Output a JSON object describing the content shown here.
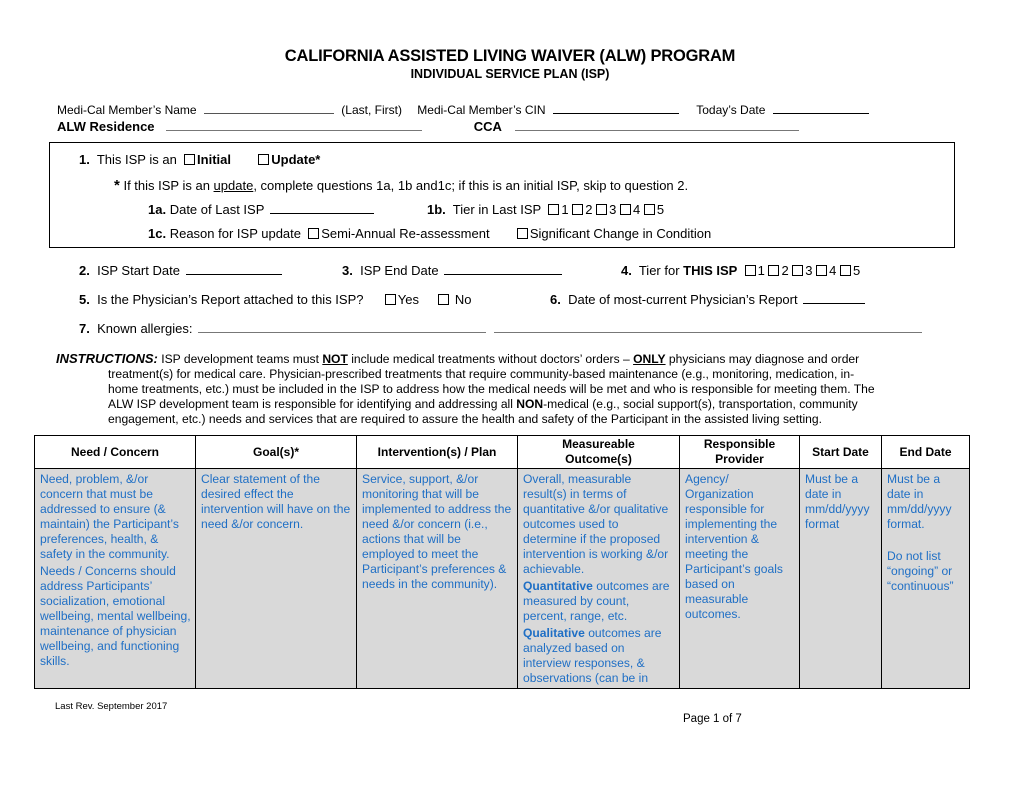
{
  "header": {
    "title": "CALIFORNIA ASSISTED LIVING WAIVER (ALW) PROGRAM",
    "subtitle": "INDIVIDUAL SERVICE PLAN (ISP)"
  },
  "member_info": {
    "name_label": "Medi-Cal Member’s Name",
    "name_value": "",
    "name_hint": "(Last, First)",
    "cin_label": "Medi-Cal Member’s CIN",
    "cin_value": "",
    "today_label": "Today’s Date",
    "today_value": "",
    "residence_label": "ALW Residence",
    "residence_value": "",
    "cca_label": "CCA",
    "cca_value": ""
  },
  "question1": {
    "number": "1.",
    "text": "This ISP is an",
    "option_initial": "Initial",
    "option_update": "Update*",
    "initial_checked": false,
    "update_checked": false,
    "note_star": "*",
    "note_pre": " If this ISP is an ",
    "note_link": "update",
    "note_post": ", complete questions 1a, 1b and1c; if this is an initial ISP, skip to question 2.",
    "q1a_num": "1a.",
    "q1a_label": "Date of Last ISP",
    "q1a_value": "",
    "q1b_num": "1b.",
    "q1b_label": "Tier in Last ISP",
    "q1b_tiers": [
      "1",
      "2",
      "3",
      "4",
      "5"
    ],
    "q1c_num": "1c.",
    "q1c_label": "Reason for ISP update",
    "q1c_option1": "Semi-Annual Re-assessment",
    "q1c_option2": "Significant Change in Condition"
  },
  "question2": {
    "number": "2.",
    "label": "ISP Start Date",
    "value": ""
  },
  "question3": {
    "number": "3.",
    "label": "ISP End Date",
    "value": ""
  },
  "question4": {
    "number": "4.",
    "label_pre": "Tier for ",
    "label_bold": "THIS ISP",
    "tiers": [
      "1",
      "2",
      "3",
      "4",
      "5"
    ]
  },
  "question5": {
    "number": "5.",
    "label": "Is the Physician’s Report attached to this ISP?",
    "yes": "Yes",
    "no": "No"
  },
  "question6": {
    "number": "6.",
    "label": "Date of most-current Physician’s Report",
    "value": ""
  },
  "question7": {
    "number": "7.",
    "label": "Known allergies:",
    "value": ""
  },
  "instructions": {
    "heading": "INSTRUCTIONS:",
    "p1": "  ISP development teams must ",
    "not": "NOT",
    "p2": " include medical treatments without doctors’ orders – ",
    "only": "ONLY",
    "p3": " physicians may diagnose and order",
    "line2": "treatment(s) for medical care.  Physician-prescribed treatments that require community-based maintenance (e.g., monitoring, medication, in-",
    "line3": "home treatments, etc.) must be included in the ISP to address how the medical needs will be met and who is responsible for meeting them.  The",
    "line4_pre": "ALW ISP development team is responsible for identifying and addressing all ",
    "non": "NON",
    "line4_post": "-medical (e.g., social support(s), transportation, community",
    "line5": "engagement, etc.) needs and services that are required to assure the health and safety of the Participant in the assisted living setting."
  },
  "table": {
    "headers": [
      "Need / Concern",
      "Goal(s)*",
      "Intervention(s) / Plan",
      "Measureable Outcome(s)",
      "Responsible Provider",
      "Start Date",
      "End Date"
    ],
    "row": {
      "need": [
        "Need, problem, &/or concern that must be addressed to ensure (& maintain) the Participant’s preferences, health, & safety in the community.",
        "Needs / Concerns should address Participants’ socialization, emotional wellbeing, mental wellbeing, maintenance of physician wellbeing, and functioning skills."
      ],
      "goal": "Clear statement of the desired effect the intervention will have on the need &/or concern.",
      "intervention": "Service, support, &/or monitoring that will be implemented to address the need &/or concern (i.e., actions that will be employed to meet the Participant’s preferences & needs in the community).",
      "outcome_p1": "Overall, measurable result(s) in terms of quantitative &/or qualitative outcomes used to determine if the proposed intervention is working &/or achievable.",
      "outcome_quant_bold": "Quantitative",
      "outcome_quant_rest": " outcomes are measured by count, percent, range, etc.",
      "outcome_qual_bold": "Qualitative",
      "outcome_qual_rest": " outcomes are analyzed based on interview responses, & observations (can be in",
      "provider": "Agency/ Organization responsible for implementing the intervention & meeting the Participant’s goals based on measurable outcomes.",
      "start": "Must be a date in mm/dd/yyyy format",
      "end_p1": "Must be a date in mm/dd/yyyy format.",
      "end_p2": "Do not list “ongoing” or “continuous”"
    }
  },
  "footer": {
    "revision": "Last Rev. September 2017",
    "page": "Page 1 of 7"
  },
  "colors": {
    "instruction_text": "#1f6fc5",
    "cell_background": "#d9d9d9"
  }
}
